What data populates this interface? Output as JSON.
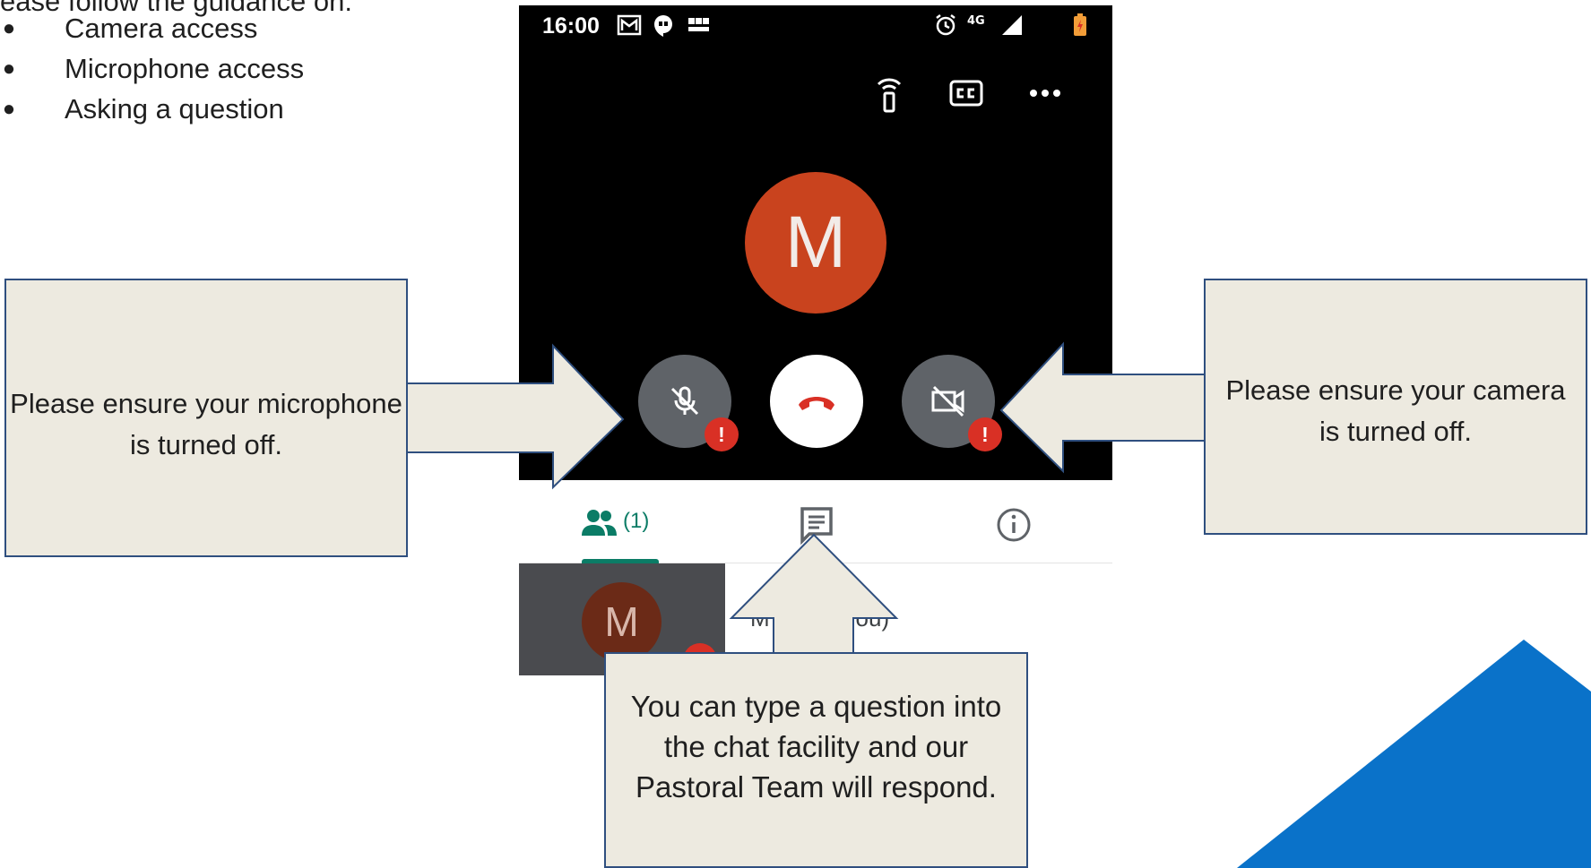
{
  "guidance": {
    "intro": "ease follow the guidance on:",
    "items": [
      {
        "bullet": "●",
        "label": "Camera access"
      },
      {
        "bullet": "●",
        "label": "Microphone access"
      },
      {
        "bullet": "●",
        "label": "Asking a question"
      }
    ]
  },
  "status_bar": {
    "time": "16:00",
    "network": "4G",
    "icons": [
      "gmail-icon",
      "hangouts-icon",
      "bbc-news-icon",
      "alarm-icon",
      "signal-icon",
      "battery-icon"
    ]
  },
  "top_actions": [
    "cast-icon",
    "closed-captions-icon",
    "more-options-icon"
  ],
  "call": {
    "avatar_initial": "M",
    "alert_symbol": "!",
    "controls": [
      "microphone-off-button",
      "hang-up-button",
      "camera-off-button"
    ]
  },
  "tabs": {
    "people_count": "(1)",
    "icons": [
      "people-icon",
      "chat-icon",
      "info-icon"
    ]
  },
  "participant": {
    "initial": "M",
    "name": "M         ndon (You)"
  },
  "callouts": {
    "microphone": "Please ensure your microphone is turned off.",
    "camera": "Please ensure your camera is turned off.",
    "chat": "You can type a question into the chat facility and our Pastoral Team will respond."
  },
  "colors": {
    "callout_fill": "#edeae0",
    "callout_border": "#2f4f7f",
    "avatar": "#c9431e",
    "alert": "#d93025",
    "accent_teal": "#0b7c66",
    "decor_blue": "#0a72c9"
  }
}
